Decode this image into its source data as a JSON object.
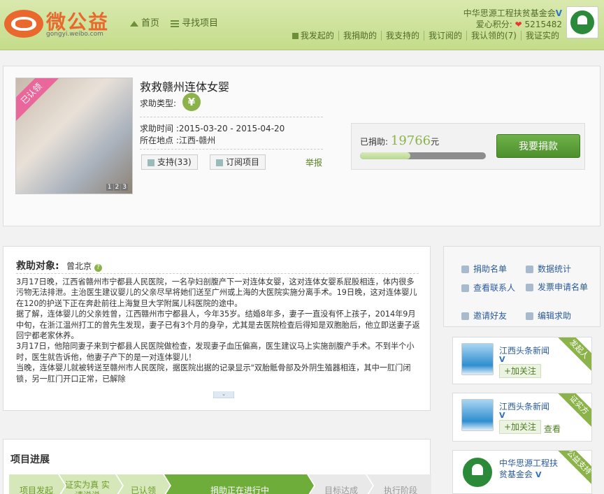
{
  "header": {
    "logo_text": "微公益",
    "logo_sub": "gongyi.weibo.com",
    "nav": {
      "home": "首页",
      "find": "寻找项目"
    },
    "org_name": "中华思源工程扶贫基金会",
    "verified_mark": "V",
    "points_label": "爱心积分:",
    "points_value": "5215482",
    "subnav": [
      "我发起的",
      "我捐助的",
      "我支持的",
      "我订阅的",
      "我认领的(7)",
      "我证实的"
    ]
  },
  "project": {
    "badge": "已认领",
    "title": "救救赣州连体女婴",
    "type_label": "求助类型:",
    "type_icon": "¥",
    "time_row": "求助时间 :2015-03-20 - 2015-04-20",
    "place_row": "所在地点 :江西-赣州",
    "support_button": "支持(33)",
    "subscribe_button": "订阅项目",
    "report_link": "举报",
    "photo_pages": [
      "1",
      "2",
      "3"
    ],
    "donated_label": "已捐助:",
    "donated_amount": "19766",
    "donated_unit": "元",
    "progress_fraction": 0.4,
    "donate_button": "我要捐款"
  },
  "help": {
    "title": "救助对象:",
    "target": "曾北京",
    "question_mark": "?",
    "paragraphs": [
      "3月17日晚，江西省赣州市宁都县人民医院，一名孕妇剖腹产下一对连体女婴，这对连体女婴系屁股相连，体内很多污物无法排泄。主治医生建议婴儿的父亲尽早将她们送至广州或上海的大医院实施分离手术。19日晚，这对连体婴儿在120的护送下正在奔赴前往上海复旦大学附属儿科医院的途中。",
      "据了解，连体婴儿的父亲姓曾，江西赣州市宁都县人，今年35岁。结婚8年多，妻子一直没有怀上孩子，2014年9月中旬，在浙江温州打工的曾先生发现，妻子已有3个月的身孕，尤其是去医院检查后得知是双胞胎后，他立即送妻子返回宁都老家休养。",
      "3月17日，他陪同妻子来到宁都县人民医院做检查，发现妻子血压偏高，医生建议马上实施剖腹产手术。不到半个小时，医生就告诉他，他妻子产下的是一对连体婴儿！",
      "当晚，连体婴儿就被转送至赣州市人民医院，据医院出据的记录显示\"双胎骶骨部及外阴生殖器相连，其中一肛门闭锁，另一肛门开口正常，已解除"
    ],
    "expand_icon": "⌄"
  },
  "progress": {
    "title": "项目进展",
    "steps": [
      "项目发起",
      "证实为真 实请说说",
      "已认领",
      "捐助正在进行中",
      "目标达成",
      "执行阶段"
    ]
  },
  "sidebar": {
    "links": [
      "捐助名单",
      "数据统计",
      "查看联系人",
      "发票申请名单",
      "邀请好友",
      "编辑求助"
    ],
    "cards": [
      {
        "name": "江西头条新闻",
        "verified": "V",
        "follow": "+加关注",
        "view": "",
        "corner": "发起人"
      },
      {
        "name": "江西头条新闻",
        "verified": "V",
        "follow": "+加关注",
        "view": "查看",
        "corner": "证实方"
      },
      {
        "name": "中华思源工程扶贫基金会",
        "verified": "V",
        "follow": "",
        "view": "",
        "corner": "公益支持"
      }
    ]
  }
}
